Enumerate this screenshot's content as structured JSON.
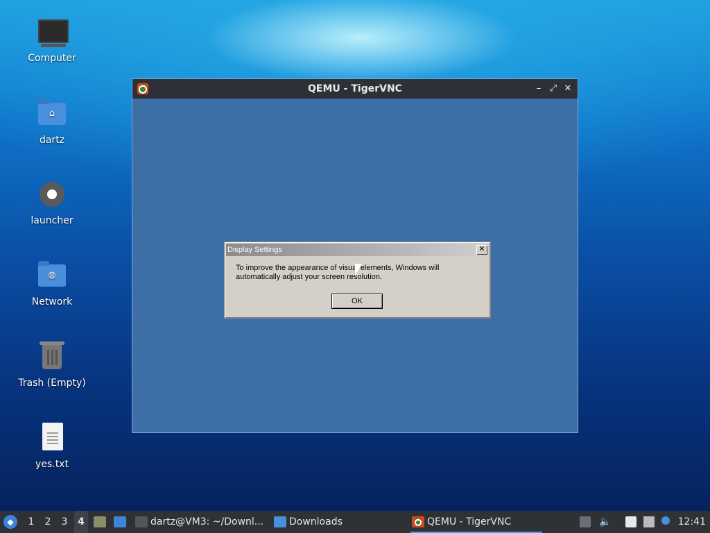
{
  "desktop": {
    "icons": [
      {
        "label": "Computer"
      },
      {
        "label": "dartz"
      },
      {
        "label": "launcher"
      },
      {
        "label": "Network"
      },
      {
        "label": "Trash (Empty)"
      },
      {
        "label": "yes.txt"
      }
    ]
  },
  "window": {
    "title": "QEMU - TigerVNC",
    "icon": "tigervnc-icon",
    "controls": {
      "minimize": "–",
      "maximize": "⤢",
      "close": "✕"
    }
  },
  "dialog": {
    "title": "Display Settings",
    "close": "✕",
    "message": "To improve the appearance of visual elements, Windows will automatically adjust your screen resolution.",
    "ok_label": "OK"
  },
  "taskbar": {
    "workspaces": [
      "1",
      "2",
      "3",
      "4"
    ],
    "active_workspace": "4",
    "tasks": [
      {
        "label": "dartz@VM3: ~/Downl...",
        "icon": "terminal-icon"
      },
      {
        "label": "Downloads",
        "icon": "folder-icon"
      },
      {
        "label": "QEMU - TigerVNC",
        "icon": "tigervnc-icon"
      }
    ],
    "clock": "12:41"
  },
  "colors": {
    "accent": "#4a9be8",
    "window_bg": "#3e6ea6",
    "taskbar_bg": "#2e3136"
  }
}
